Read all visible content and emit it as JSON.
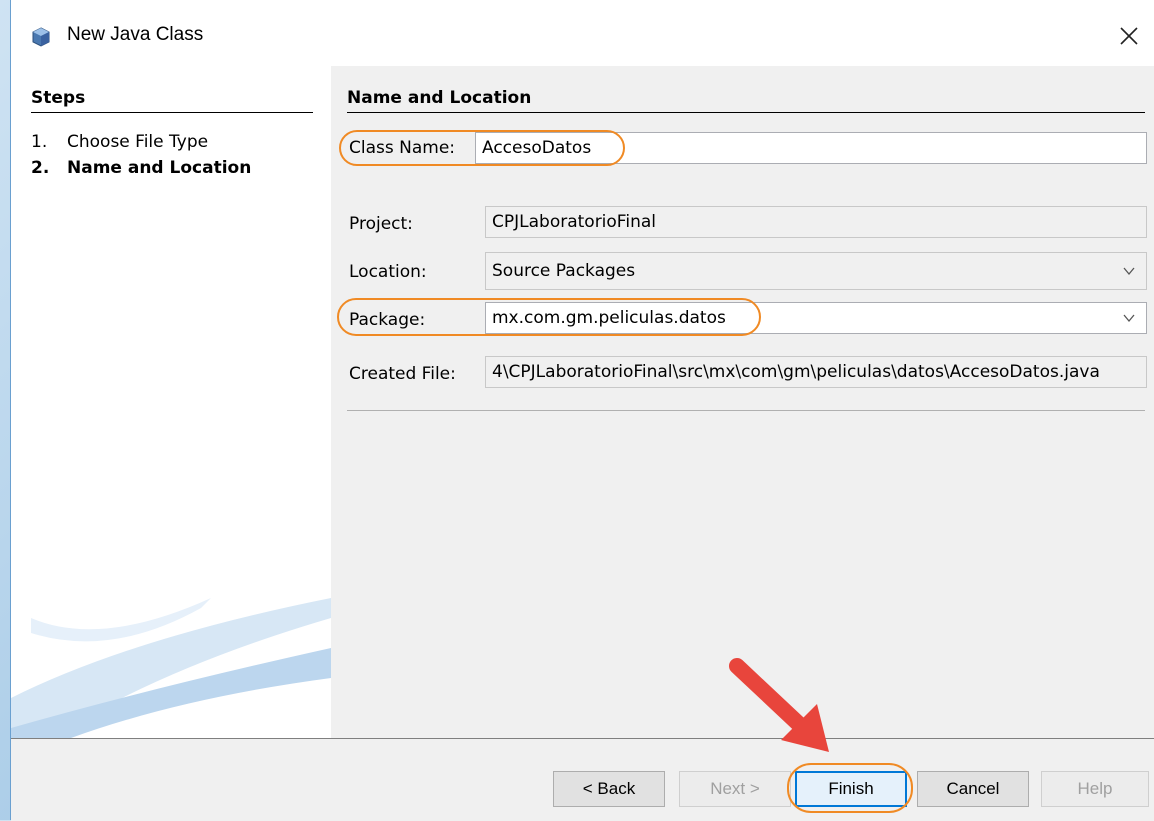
{
  "window": {
    "title": "New Java Class",
    "icon": "java-class-cube-icon",
    "close_icon": "close-icon"
  },
  "steps": {
    "title": "Steps",
    "items": [
      {
        "num": "1.",
        "label": "Choose File Type"
      },
      {
        "num": "2.",
        "label": "Name and Location"
      }
    ]
  },
  "main": {
    "section_title": "Name and Location",
    "class_name": {
      "label": "Class Name:",
      "value": "AccesoDatos"
    },
    "project": {
      "label": "Project:",
      "value": "CPJLaboratorioFinal"
    },
    "location": {
      "label": "Location:",
      "value": "Source Packages"
    },
    "package": {
      "label": "Package:",
      "value": "mx.com.gm.peliculas.datos"
    },
    "created_file": {
      "label": "Created File:",
      "value": "4\\CPJLaboratorioFinal\\src\\mx\\com\\gm\\peliculas\\datos\\AccesoDatos.java"
    }
  },
  "buttons": {
    "back": "< Back",
    "next": "Next >",
    "finish": "Finish",
    "cancel": "Cancel",
    "help": "Help"
  },
  "colors": {
    "highlight": "#f08a24",
    "arrow": "#e8453c",
    "default_button_border": "#0078d7"
  }
}
